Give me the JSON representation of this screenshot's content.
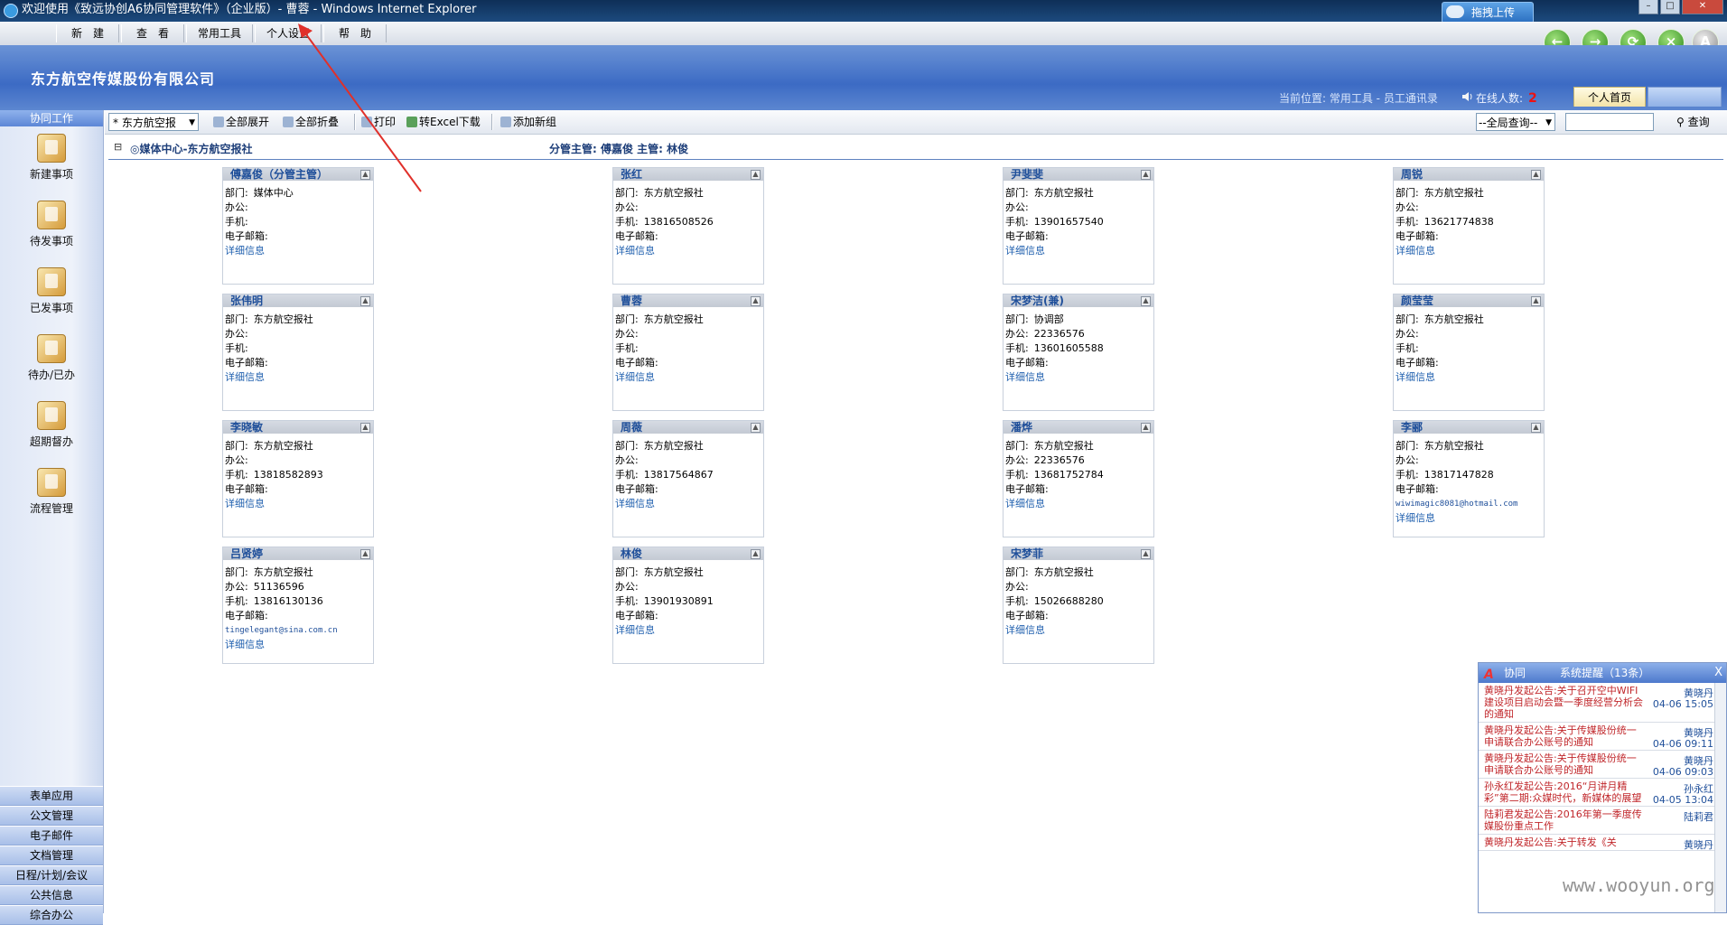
{
  "window": {
    "title": "欢迎使用《致远协创A6协同管理软件》（企业版）- 曹蓉 - Windows Internet Explorer",
    "upload_label": "拖拽上传"
  },
  "menubar": [
    "新　建",
    "查　看",
    "常用工具",
    "个人设置",
    "帮　助"
  ],
  "header": {
    "company": "东方航空传媒股份有限公司",
    "location": "当前位置: 常用工具 - 员工通讯录",
    "online_label": "在线人数:",
    "online_count": "2",
    "home_tab": "个人首页"
  },
  "sidebar": {
    "head": "协同工作",
    "items": [
      "新建事项",
      "待发事项",
      "已发事项",
      "待办/已办",
      "超期督办",
      "流程管理"
    ],
    "categories": [
      "表单应用",
      "公文管理",
      "电子邮件",
      "文档管理",
      "日程/计划/会议",
      "公共信息",
      "综合办公"
    ]
  },
  "toolbar": {
    "dept_select": "* 东方航空报",
    "expand_all": "全部展开",
    "collapse_all": "全部折叠",
    "print": "打印",
    "excel": "转Excel下载",
    "add_group": "添加新组",
    "global_search": "--全局查询--",
    "search": "查询"
  },
  "group": {
    "name": "媒体中心-东方航空报社",
    "managers": "分管主管: 傅嘉俊 主管: 林俊"
  },
  "labels": {
    "dept": "部门:",
    "office": "办公:",
    "mobile": "手机:",
    "email": "电子邮箱:",
    "detail": "详细信息"
  },
  "contacts": [
    {
      "name": "傅嘉俊（分管主管）",
      "dept": "媒体中心",
      "office": "",
      "mobile": "",
      "email": ""
    },
    {
      "name": "张红",
      "dept": "东方航空报社",
      "office": "",
      "mobile": "13816508526",
      "email": ""
    },
    {
      "name": "尹斐斐",
      "dept": "东方航空报社",
      "office": "",
      "mobile": "13901657540",
      "email": ""
    },
    {
      "name": "周锐",
      "dept": "东方航空报社",
      "office": "",
      "mobile": "13621774838",
      "email": ""
    },
    {
      "name": "张伟明",
      "dept": "东方航空报社",
      "office": "",
      "mobile": "",
      "email": ""
    },
    {
      "name": "曹蓉",
      "dept": "东方航空报社",
      "office": "",
      "mobile": "",
      "email": ""
    },
    {
      "name": "宋梦洁(兼)",
      "dept": "协调部",
      "office": "22336576",
      "mobile": "13601605588",
      "email": ""
    },
    {
      "name": "颜莹莹",
      "dept": "东方航空报社",
      "office": "",
      "mobile": "",
      "email": ""
    },
    {
      "name": "李晓敏",
      "dept": "东方航空报社",
      "office": "",
      "mobile": "13818582893",
      "email": ""
    },
    {
      "name": "周薇",
      "dept": "东方航空报社",
      "office": "",
      "mobile": "13817564867",
      "email": ""
    },
    {
      "name": "潘烨",
      "dept": "东方航空报社",
      "office": "22336576",
      "mobile": "13681752784",
      "email": ""
    },
    {
      "name": "李郦",
      "dept": "东方航空报社",
      "office": "",
      "mobile": "13817147828",
      "email": "wiwimagic8081@hotmail.com"
    },
    {
      "name": "吕贤婷",
      "dept": "东方航空报社",
      "office": "51136596",
      "mobile": "13816130136",
      "email": "tingelegant@sina.com.cn"
    },
    {
      "name": "林俊",
      "dept": "东方航空报社",
      "office": "",
      "mobile": "13901930891",
      "email": ""
    },
    {
      "name": "宋梦菲",
      "dept": "东方航空报社",
      "office": "",
      "mobile": "15026688280",
      "email": ""
    }
  ],
  "notify": {
    "tab1": "协同",
    "tab2": "系统提醒（13条）",
    "close": "X",
    "items": [
      {
        "text": "黄晓丹发起公告:关于召开空中WIFI建设项目启动会暨一季度经营分析会的通知",
        "who": "黄晓丹",
        "time": "04-06 15:05"
      },
      {
        "text": "黄晓丹发起公告:关于传媒股份统一申请联合办公账号的通知",
        "who": "黄晓丹",
        "time": "04-06 09:11"
      },
      {
        "text": "黄晓丹发起公告:关于传媒股份统一申请联合办公账号的通知",
        "who": "黄晓丹",
        "time": "04-06 09:03"
      },
      {
        "text": "孙永红发起公告:2016“月讲月精彩”第二期:众媒时代，新媒体的展望",
        "who": "孙永红",
        "time": "04-05 13:04"
      },
      {
        "text": "陆莉君发起公告:2016年第一季度传媒股份重点工作",
        "who": "陆莉君",
        "time": ""
      },
      {
        "text": "黄晓丹发起公告:关于转发《关",
        "who": "黄晓丹",
        "time": ""
      }
    ]
  },
  "watermark": "www.wooyun.org",
  "colors": {
    "accent": "#3c6bc4",
    "link": "#1f5fae",
    "alert": "#c0262a"
  }
}
